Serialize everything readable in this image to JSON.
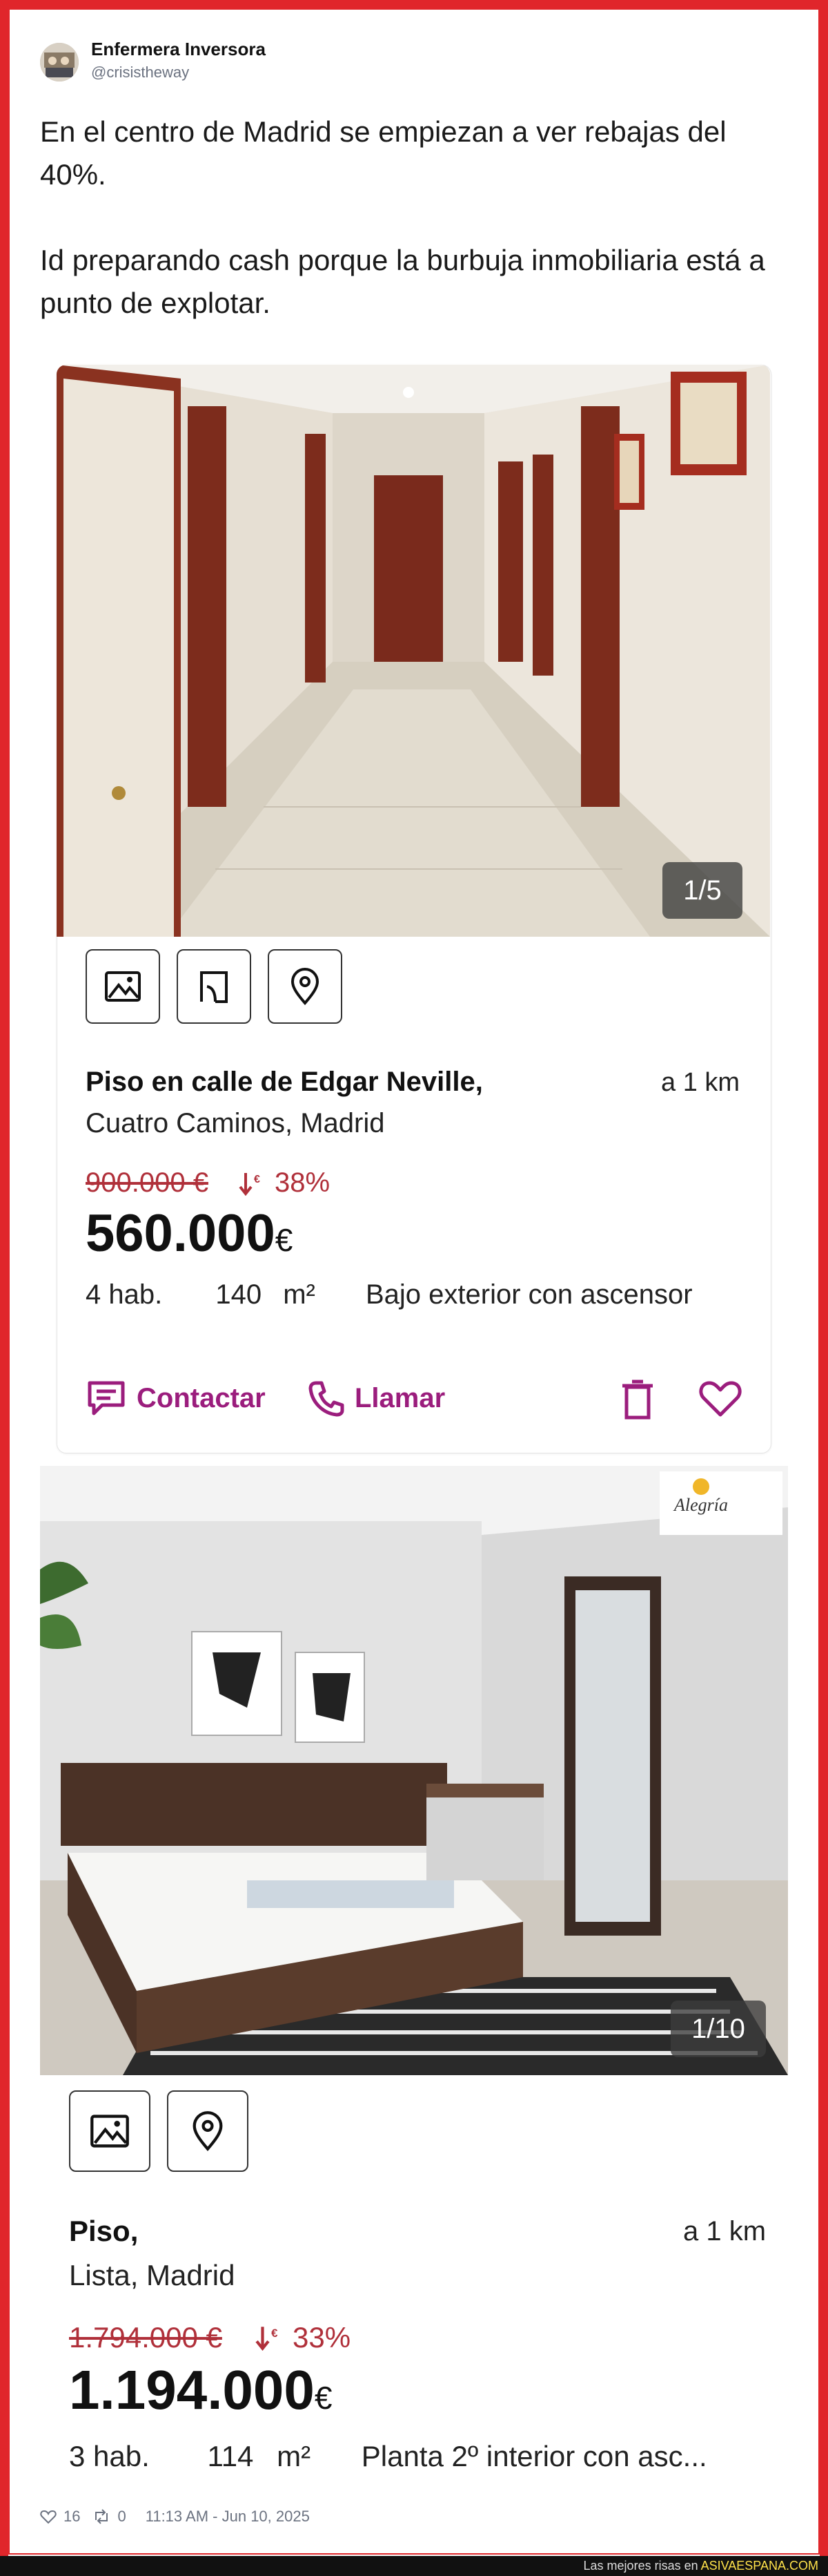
{
  "author": {
    "name": "Enfermera Inversora",
    "handle": "@crisistheway"
  },
  "tweet": {
    "text": "En el centro de Madrid se empiezan a ver rebajas del 40%.\n\nId preparando cash porque la burbuja inmobiliaria está a punto de explotar."
  },
  "listing1": {
    "photo_icon": "hallway-photo",
    "counter": "1/5",
    "buttons": [
      "image-icon",
      "floorplan-icon",
      "map-pin-icon"
    ],
    "title": "Piso en calle de Edgar Neville,",
    "location": "Cuatro Caminos, Madrid",
    "distance": "a 1 km",
    "old_price": "900.000 €",
    "discount": "38%",
    "price": "560.000",
    "currency": "€",
    "rooms": "4 hab.",
    "area": "140",
    "area_unit": "m²",
    "floor": "Bajo exterior con ascensor",
    "contact_label": "Contactar",
    "call_label": "Llamar",
    "accent_color": "#9b1d7d"
  },
  "listing2": {
    "photo_icon": "bedroom-photo",
    "agency_logo": "Alegria",
    "counter": "1/10",
    "buttons": [
      "image-icon",
      "map-pin-icon"
    ],
    "title": "Piso,",
    "location": "Lista, Madrid",
    "distance": "a 1 km",
    "old_price": "1.794.000 €",
    "discount": "33%",
    "price": "1.194.000",
    "currency": "€",
    "rooms": "3 hab.",
    "area": "114",
    "area_unit": "m²",
    "floor": "Planta 2º interior con asc..."
  },
  "meta": {
    "likes": "16",
    "retweets": "0",
    "timestamp": "11:13 AM - Jun 10, 2025"
  },
  "footer": {
    "text": "Las mejores risas en ",
    "site": "ASIVAESPANA.COM"
  },
  "colors": {
    "frame": "#e0262b",
    "price_drop": "#b0303a"
  }
}
